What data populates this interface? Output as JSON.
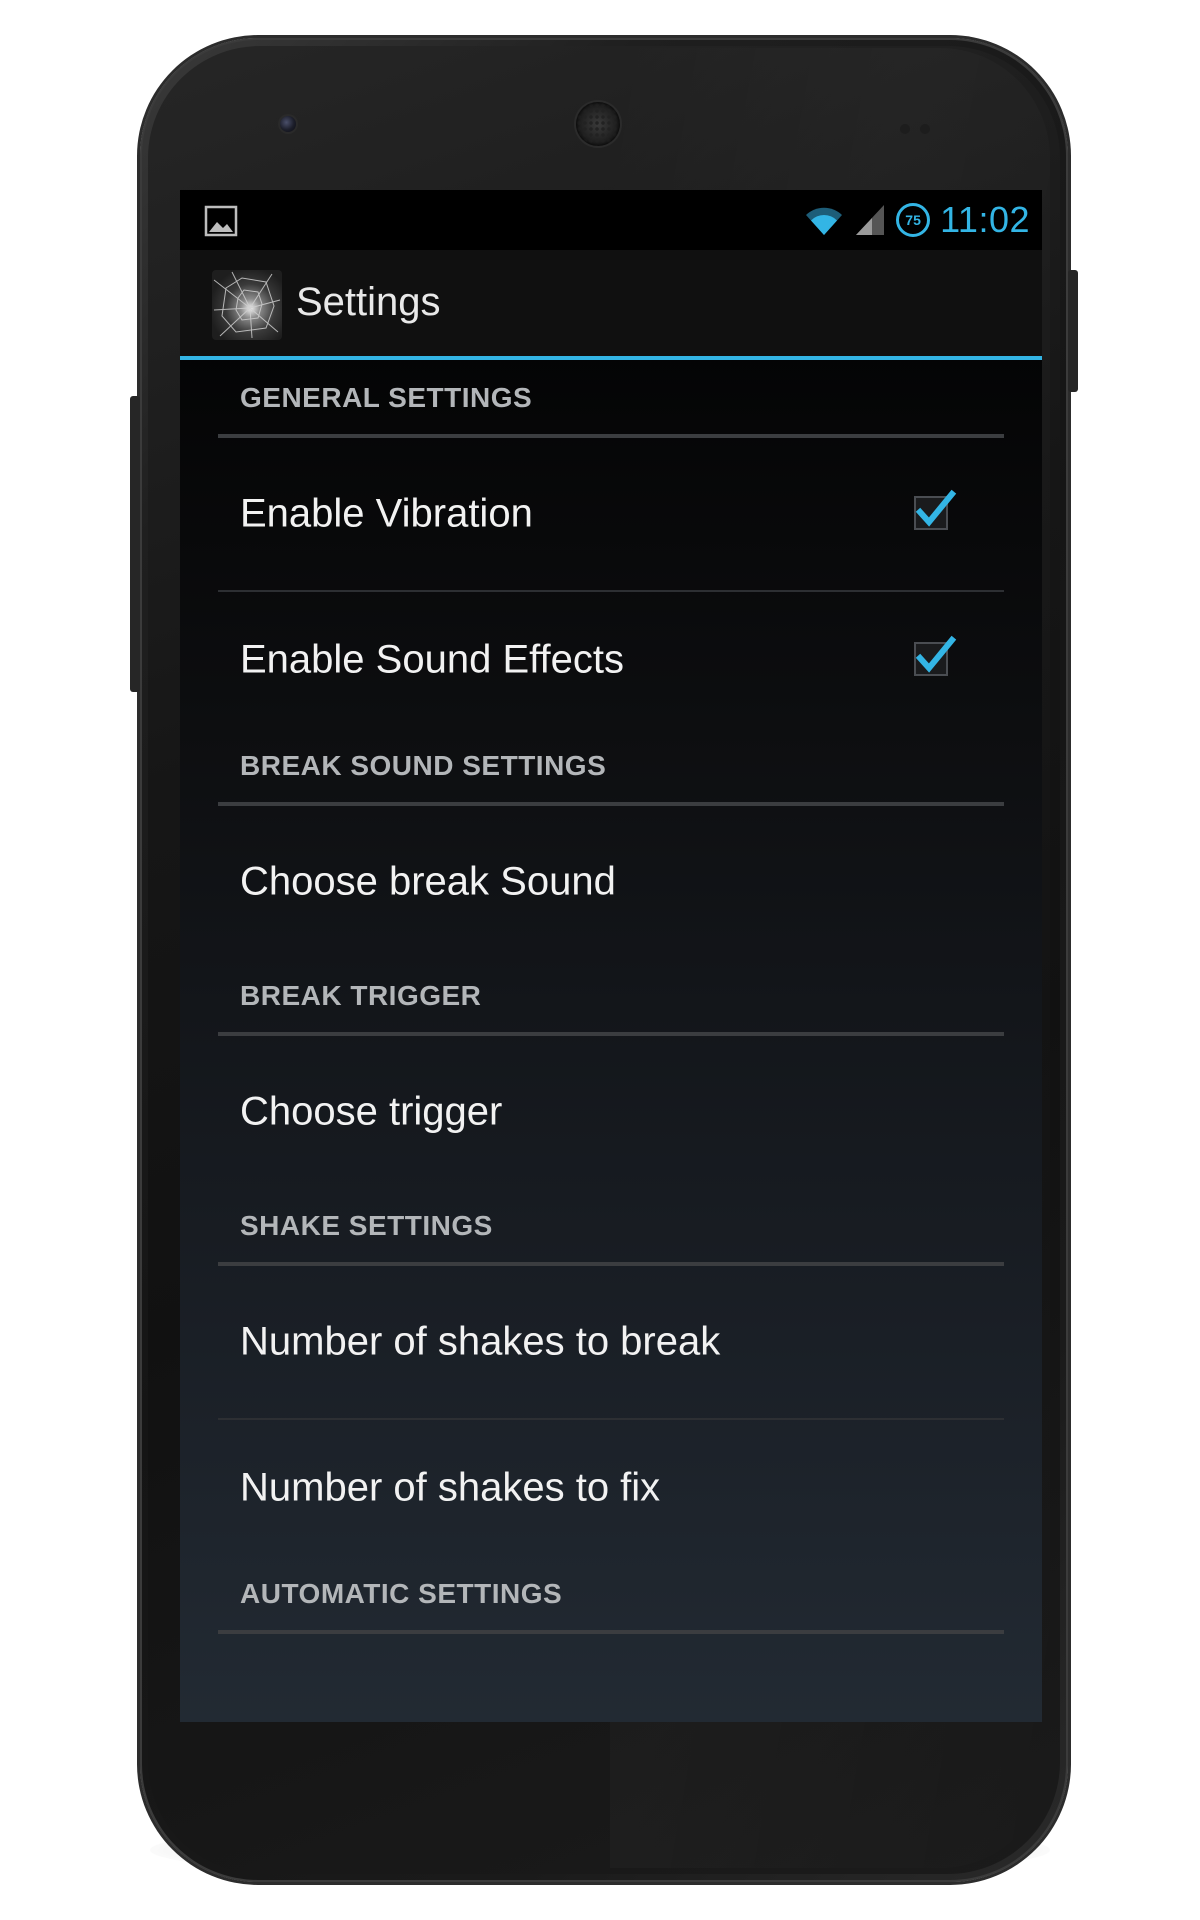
{
  "status_bar": {
    "time": "11:02",
    "battery_level": "75",
    "icons": [
      "image-notification-icon",
      "wifi-icon",
      "cell-signal-icon",
      "battery-circle-icon"
    ],
    "accent_color": "#33b5e5"
  },
  "action_bar": {
    "title": "Settings",
    "icon": "cracked-glass-app-icon"
  },
  "sections": [
    {
      "header": "GENERAL SETTINGS",
      "items": [
        {
          "label": "Enable Vibration",
          "checkbox": true,
          "checked": true
        },
        {
          "label": "Enable Sound Effects",
          "checkbox": true,
          "checked": true
        }
      ]
    },
    {
      "header": "BREAK SOUND SETTINGS",
      "items": [
        {
          "label": "Choose break Sound"
        }
      ]
    },
    {
      "header": "BREAK TRIGGER",
      "items": [
        {
          "label": "Choose trigger"
        }
      ]
    },
    {
      "header": "SHAKE SETTINGS",
      "items": [
        {
          "label": "Number of shakes to break"
        },
        {
          "label": "Number of shakes to fix"
        }
      ]
    },
    {
      "header": "AUTOMATIC SETTINGS",
      "items": []
    }
  ]
}
